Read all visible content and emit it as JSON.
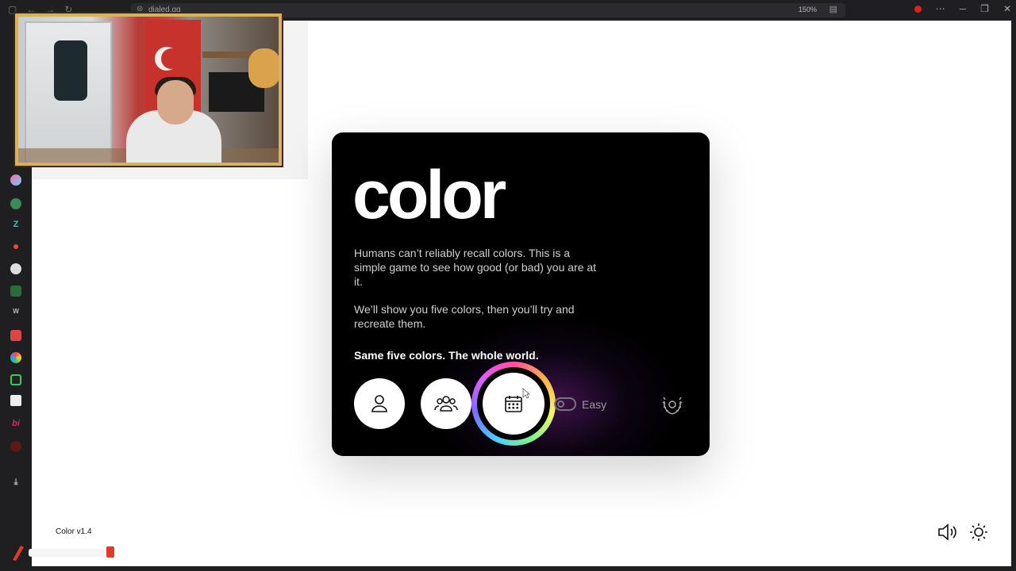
{
  "browser": {
    "url": "dialed.gg",
    "zoom": "150%"
  },
  "card": {
    "title": "color",
    "paragraph1": "Humans can’t reliably recall colors. This is a simple game to see how good (or bad) you are at it.",
    "paragraph2": "We’ll show you five colors, then you’ll try and recreate them.",
    "tagline": "Same five colors. The whole world.",
    "difficulty_label": "Easy",
    "difficulty_toggle_on": false
  },
  "footer": {
    "version": "Color v1.4"
  },
  "icons": [
    "user-icon",
    "group-icon",
    "calendar-icon",
    "laurel-icon",
    "speaker-icon",
    "sun-icon"
  ],
  "colors": {
    "card_bg": "#000000",
    "page_bg": "#ffffff",
    "ring_gradient": [
      "#ff4fa0",
      "#ffb347",
      "#f4f56b",
      "#7df08b",
      "#4ad0ff",
      "#7b6cff",
      "#e05cff"
    ]
  }
}
